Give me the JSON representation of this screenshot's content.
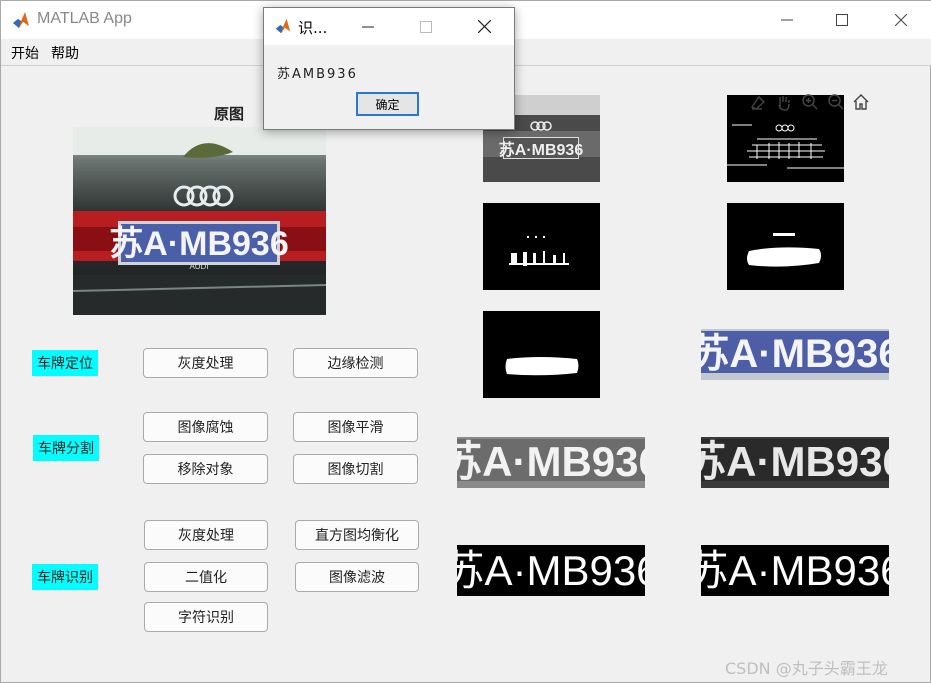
{
  "window": {
    "title": "MATLAB App"
  },
  "menu": [
    "开始",
    "帮助"
  ],
  "original": {
    "title": "原图",
    "plate_text": "苏A·MB936",
    "badge_text": "AUDI"
  },
  "plate_text": "苏A·MB936",
  "sections": {
    "locate": "车牌定位",
    "segment": "车牌分割",
    "recognize": "车牌识别"
  },
  "buttons": {
    "gray1": "灰度处理",
    "edge": "边缘检测",
    "erode": "图像腐蚀",
    "smooth": "图像平滑",
    "remove": "移除对象",
    "cut": "图像切割",
    "gray2": "灰度处理",
    "histeq": "直方图均衡化",
    "binary": "二值化",
    "filter": "图像滤波",
    "charrec": "字符识别"
  },
  "dialog": {
    "title": "识...",
    "message": "苏AMB936",
    "ok": "确定"
  },
  "watermark": "CSDN @丸子头霸王龙",
  "colors": {
    "accent": "#00ffff",
    "ok_border": "#2a78d6"
  }
}
